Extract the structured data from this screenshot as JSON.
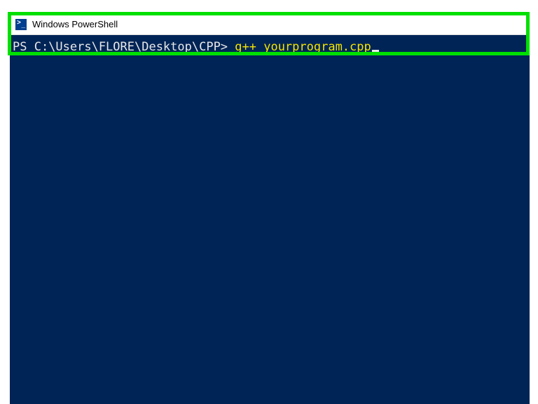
{
  "window": {
    "title": "Windows PowerShell"
  },
  "terminal": {
    "prompt": "PS C:\\Users\\FLORE\\Desktop\\CPP> ",
    "command": "g++ yourprogram.cpp"
  }
}
